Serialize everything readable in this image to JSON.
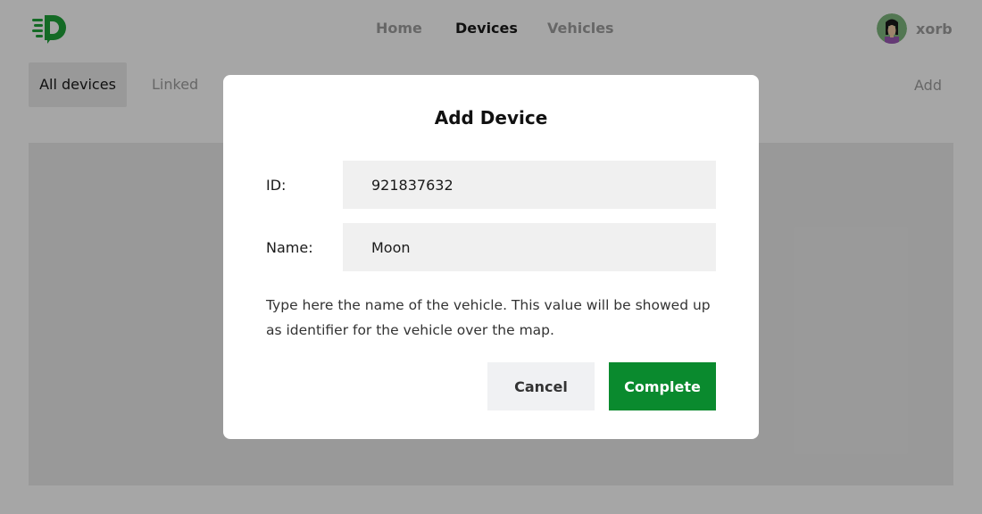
{
  "nav": {
    "items": [
      {
        "label": "Home",
        "active": false
      },
      {
        "label": "Devices",
        "active": true
      },
      {
        "label": "Vehicles",
        "active": false
      }
    ]
  },
  "user": {
    "name": "xorb",
    "avatar_icon": "user-avatar-icon"
  },
  "logo_icon": "brand-logo-icon",
  "subnav": {
    "tabs": [
      {
        "label": "All devices",
        "active": true
      },
      {
        "label": "Linked",
        "active": false
      }
    ],
    "add_label": "Add"
  },
  "modal": {
    "title": "Add Device",
    "fields": {
      "id": {
        "label": "ID:",
        "value": "921837632"
      },
      "name": {
        "label": "Name:",
        "value": "Moon"
      }
    },
    "helper_text": "Type here the name of the vehicle. This value will be showed up as identifier for the vehicle over the map.",
    "cancel_label": "Cancel",
    "complete_label": "Complete"
  },
  "colors": {
    "accent": "#0a8a2e",
    "overlay": "rgba(0,0,0,0.35)",
    "input_bg": "#f0f0f0"
  }
}
